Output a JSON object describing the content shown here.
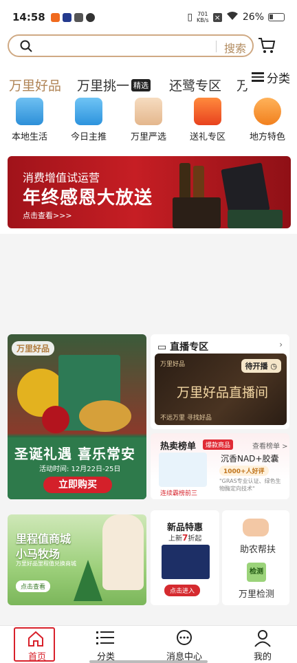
{
  "status_bar": {
    "time": "14:58",
    "net_speed": "701",
    "net_unit": "KB/s",
    "battery": "26%"
  },
  "search": {
    "placeholder": "",
    "button": "搜索"
  },
  "tabs": [
    {
      "label": "万里好品",
      "active": true
    },
    {
      "label": "万里挑一",
      "tag": "精选"
    },
    {
      "label": "还鹭专区"
    },
    {
      "label": "万"
    }
  ],
  "category_button": "分类",
  "categories": [
    {
      "label": "本地生活",
      "icon": "shop-icon"
    },
    {
      "label": "今日主推",
      "icon": "calendar-like-icon"
    },
    {
      "label": "万里严选",
      "icon": "crown-icon"
    },
    {
      "label": "送礼专区",
      "icon": "gift-icon"
    },
    {
      "label": "地方特色",
      "icon": "location-icon"
    }
  ],
  "banner": {
    "line1": "消费增值试运营",
    "line2": "年终感恩大放送",
    "line3": "点击查看>>>"
  },
  "xmas_card": {
    "brand": "万里好品",
    "title": "圣诞礼遇 喜乐常安",
    "time": "活动时间: 12月22日-25日",
    "button": "立即购买"
  },
  "live_card": {
    "title": "直播专区",
    "badge": "待开播",
    "screen_brand": "万里好品",
    "screen_title": "万里好品直播间",
    "slogan": "不远万里 寻找好品"
  },
  "hot_card": {
    "title": "热卖榜单",
    "tag": "爆款商品",
    "more": "查看榜单 >",
    "rank": "连续霸榜前三",
    "product": "沉香NAD+胶囊",
    "reviews": "1000+人好评",
    "quote": "\"GRAS专业认证、绿色生物酶定向技术\""
  },
  "ranch_card": {
    "title1": "里程值商城",
    "title2": "小马牧场",
    "desc": "万里好品里程值兑换商城",
    "button": "点击查看"
  },
  "new_card": {
    "title": "新品特惠",
    "prefix": "上新",
    "discount": "7",
    "suffix": "折起",
    "button": "点击进入"
  },
  "help_card": {
    "label1": "助农帮扶",
    "label2": "万里检测",
    "check_icon_text": "检测"
  },
  "nav": [
    {
      "label": "首页",
      "icon": "home-icon",
      "active": true
    },
    {
      "label": "分类",
      "icon": "list-icon"
    },
    {
      "label": "消息中心",
      "icon": "chat-icon"
    },
    {
      "label": "我的",
      "icon": "user-icon"
    }
  ],
  "colors": {
    "accent": "#b08456",
    "red": "#d8202a"
  }
}
